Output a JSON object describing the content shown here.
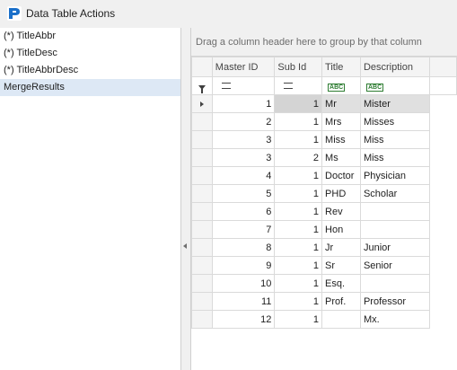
{
  "window": {
    "title": "Data Table Actions",
    "icon": "app-logo-icon",
    "accent": "#1a6fc9"
  },
  "left_list": {
    "items": [
      {
        "label": "(*) TitleAbbr",
        "selected": false
      },
      {
        "label": "(*) TitleDesc",
        "selected": false
      },
      {
        "label": "(*) TitleAbbrDesc",
        "selected": false
      },
      {
        "label": "MergeResults",
        "selected": true
      }
    ]
  },
  "grid": {
    "group_prompt": "Drag a column header here to group by that column",
    "columns": [
      "Master ID",
      "Sub Id",
      "Title",
      "Description"
    ],
    "filter_icons": [
      "filter-icon",
      "equals-icon",
      "equals-icon",
      "text-filter-icon",
      "text-filter-icon"
    ],
    "rows": [
      {
        "master_id": "1",
        "sub_id": "1",
        "title": "Mr",
        "description": "Mister"
      },
      {
        "master_id": "2",
        "sub_id": "1",
        "title": "Mrs",
        "description": "Misses"
      },
      {
        "master_id": "3",
        "sub_id": "1",
        "title": "Miss",
        "description": "Miss"
      },
      {
        "master_id": "3",
        "sub_id": "2",
        "title": "Ms",
        "description": "Miss"
      },
      {
        "master_id": "4",
        "sub_id": "1",
        "title": "Doctor",
        "description": "Physician"
      },
      {
        "master_id": "5",
        "sub_id": "1",
        "title": "PHD",
        "description": "Scholar"
      },
      {
        "master_id": "6",
        "sub_id": "1",
        "title": "Rev",
        "description": ""
      },
      {
        "master_id": "7",
        "sub_id": "1",
        "title": "Hon",
        "description": ""
      },
      {
        "master_id": "8",
        "sub_id": "1",
        "title": "Jr",
        "description": "Junior"
      },
      {
        "master_id": "9",
        "sub_id": "1",
        "title": "Sr",
        "description": "Senior"
      },
      {
        "master_id": "10",
        "sub_id": "1",
        "title": "Esq.",
        "description": ""
      },
      {
        "master_id": "11",
        "sub_id": "1",
        "title": "Prof.",
        "description": "Professor"
      },
      {
        "master_id": "12",
        "sub_id": "1",
        "title": "",
        "description": "Mx."
      }
    ]
  }
}
